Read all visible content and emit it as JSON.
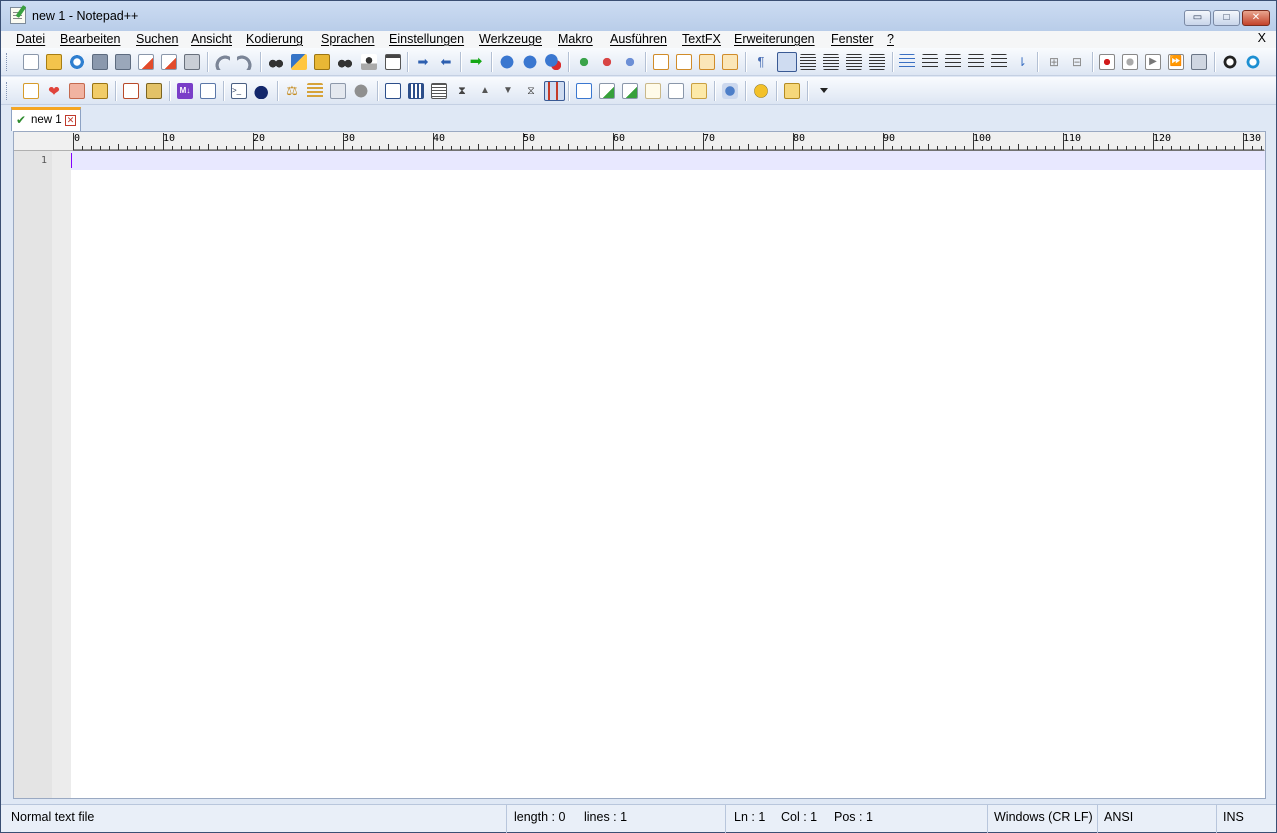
{
  "window": {
    "title": "new 1 - Notepad++",
    "minimize_glyph": "▭",
    "maximize_glyph": "□",
    "close_glyph": "✕"
  },
  "menu": {
    "items": [
      "Datei",
      "Bearbeiten",
      "Suchen",
      "Ansicht",
      "Kodierung",
      "Sprachen",
      "Einstellungen",
      "Werkzeuge",
      "Makro",
      "Ausführen",
      "TextFX",
      "Erweiterungen",
      "Fenster",
      "?"
    ],
    "close_label": "X"
  },
  "toolbar1": {
    "icons": [
      "new-file-icon",
      "open-file-icon",
      "reload-icon",
      "save-icon",
      "save-all-icon",
      "close-icon",
      "close-all-icon",
      "print-icon",
      "undo-icon",
      "redo-icon",
      "find-icon",
      "replace-icon",
      "find-in-files-icon",
      "find-next-icon",
      "find-prev-icon",
      "zoom-in-icon",
      "go-forward-icon",
      "go-back-icon",
      "run-icon",
      "sync-v-icon",
      "sync-h-icon",
      "stop-icon",
      "bookmark-next-icon",
      "bookmark-prev-icon",
      "bookmark-clear-icon",
      "wrap-icon",
      "show-all-chars-icon",
      "indent-guide-icon",
      "pilcrow-icon",
      "word-wrap-icon",
      "macro-record-icon",
      "macro-stop-icon",
      "macro-play-icon",
      "macro-run-multiple-icon",
      "macro-save-icon",
      "plugin-a-icon",
      "plugin-b-icon"
    ]
  },
  "toolbar2": {
    "icons": [
      "mark-icon",
      "heart-icon",
      "folder-icon",
      "archive-icon",
      "tool-a-icon",
      "tool-b-icon",
      "markdown-icon",
      "export-icon",
      "console-icon",
      "bomb-icon",
      "compare-icon",
      "compare-left-icon",
      "compare-right-icon",
      "gray-circle-icon",
      "download-icon",
      "panel-a-icon",
      "panel-b-icon",
      "collapse-icon",
      "up-arrow-icon",
      "down-arrow-icon",
      "expand-icon",
      "panel-c-icon",
      "tool-c-icon",
      "doc-check-icon",
      "doc-go-icon",
      "doc-a-icon",
      "doc-b-icon",
      "doc-c-icon",
      "network-icon",
      "smiley-icon",
      "folder-edit-icon"
    ]
  },
  "tab": {
    "label": "new 1",
    "close_glyph": "✕"
  },
  "ruler": {
    "labels": [
      "0",
      "10",
      "20",
      "30",
      "40",
      "50",
      "60",
      "70",
      "80",
      "90",
      "100",
      "110",
      "120",
      "130"
    ]
  },
  "editor": {
    "line_numbers": [
      "1"
    ],
    "content": ""
  },
  "status": {
    "file_type": "Normal text file",
    "length": "length : 0",
    "lines": "lines : 1",
    "ln": "Ln : 1",
    "col": "Col : 1",
    "pos": "Pos : 1",
    "eol": "Windows (CR LF)",
    "encoding": "ANSI",
    "mode": "INS"
  }
}
